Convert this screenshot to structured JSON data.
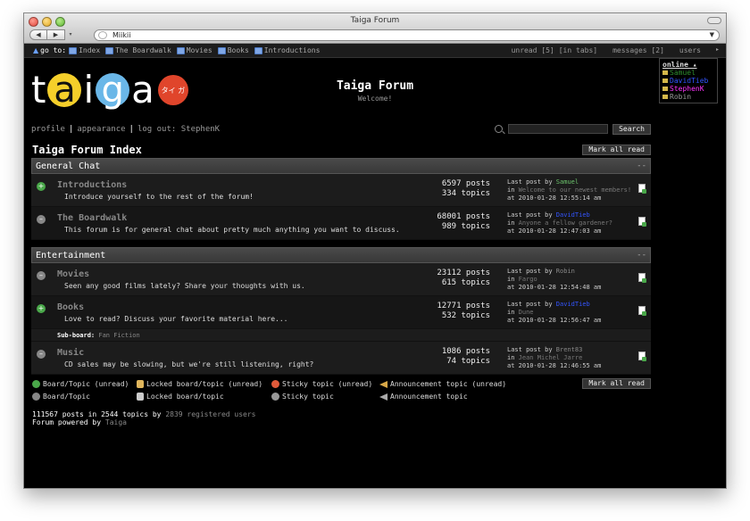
{
  "window": {
    "title": "Taiga Forum",
    "url": "Miikii"
  },
  "browser": {
    "back": "◀",
    "forward": "▶",
    "dropdown": "▾",
    "url_arrow": "▼"
  },
  "topbar": {
    "goto_label": "go to:",
    "links": [
      "Index",
      "The Boardwalk",
      "Movies",
      "Books",
      "Introductions"
    ],
    "unread": "unread [5]",
    "in_tabs": "[in tabs]",
    "messages": "messages [2]",
    "users": "users",
    "arrow": "▸"
  },
  "online": {
    "title": "online ▴",
    "users": [
      {
        "name": "Samuel",
        "color": "#2e8b2e"
      },
      {
        "name": "DavidTieb",
        "color": "#3355ff"
      },
      {
        "name": "StephenK",
        "color": "#ff33ff"
      },
      {
        "name": "Robin",
        "color": "#999999"
      }
    ]
  },
  "header": {
    "logo_letters": [
      "t",
      "a",
      "i",
      "g",
      "a"
    ],
    "logo_seal": "タイ\nガ",
    "title": "Taiga Forum",
    "subtitle": "Welcome!"
  },
  "userbar": {
    "profile": "profile",
    "appearance": "appearance",
    "logout": "log out: StephenK",
    "sep": "|",
    "search_button": "Search",
    "search_value": ""
  },
  "index": {
    "title": "Taiga Forum Index",
    "mark_all": "Mark all read"
  },
  "categories": [
    {
      "name": "General Chat",
      "collapse": "--",
      "boards": [
        {
          "status": "unread",
          "title": "Introductions",
          "desc": "Introduce yourself to the rest of the forum!",
          "posts": "6597 posts",
          "topics": "334 topics",
          "last_label": "Last post by",
          "last_user": "Samuel",
          "in_label": "in",
          "last_thread": "Welcome to our newest members!",
          "at": "at 2010-01-28 12:55:14 am"
        },
        {
          "status": "read",
          "title": "The Boardwalk",
          "desc": "This forum is for general chat about pretty much anything you want to discuss.",
          "posts": "68001 posts",
          "topics": "989 topics",
          "last_label": "Last post by",
          "last_user": "DavidTieb",
          "in_label": "in",
          "last_thread": "Anyone a fellow gardener?",
          "at": "at 2010-01-28 12:47:03 am"
        }
      ]
    },
    {
      "name": "Entertainment",
      "collapse": "--",
      "boards": [
        {
          "status": "read",
          "title": "Movies",
          "desc": "Seen any good films lately? Share your thoughts with us.",
          "posts": "23112 posts",
          "topics": "615 topics",
          "last_label": "Last post by",
          "last_user": "Robin",
          "in_label": "in",
          "last_thread": "Fargo",
          "at": "at 2010-01-28 12:54:48 am"
        },
        {
          "status": "unread",
          "title": "Books",
          "desc": "Love to read? Discuss your favorite material here...",
          "posts": "12771 posts",
          "topics": "532 topics",
          "last_label": "Last post by",
          "last_user": "DavidTieb",
          "in_label": "in",
          "last_thread": "Dune",
          "at": "at 2010-01-28 12:56:47 am"
        },
        {
          "status": "read",
          "title": "Music",
          "desc": "CD sales may be slowing, but we're still listening, right?",
          "posts": "1086 posts",
          "topics": "74 topics",
          "last_label": "Last post by",
          "last_user": "Brent83",
          "in_label": "in",
          "last_thread": "Jean Michel Jarre",
          "at": "at 2010-01-28 12:46:55 am"
        }
      ],
      "subboard": {
        "label": "Sub-board:",
        "name": "Fan Fiction"
      }
    }
  ],
  "legend": {
    "board_unread": "Board/Topic (unread)",
    "locked_unread": "Locked board/topic (unread)",
    "sticky_unread": "Sticky topic (unread)",
    "announce_unread": "Announcement topic (unread)",
    "board": "Board/Topic",
    "locked": "Locked board/topic",
    "sticky": "Sticky topic",
    "announce": "Announcement topic"
  },
  "footer": {
    "stats_prefix": "111567 posts in 2544 topics by",
    "registered": "2839 registered users",
    "powered_prefix": "Forum powered by",
    "powered_name": "Taiga"
  }
}
